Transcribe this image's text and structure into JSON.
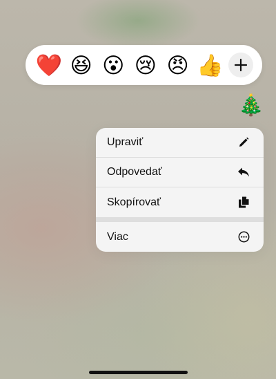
{
  "reactions": [
    {
      "emoji": "❤️",
      "name": "red-heart"
    },
    {
      "emoji": "😆",
      "name": "laughing"
    },
    {
      "emoji": "😮",
      "name": "surprised"
    },
    {
      "emoji": "😢",
      "name": "crying"
    },
    {
      "emoji": "😠",
      "name": "angry"
    },
    {
      "emoji": "👍",
      "name": "thumbs-up"
    }
  ],
  "add_reaction_icon": "plus-icon",
  "message": {
    "emoji": "🎄"
  },
  "menu": {
    "items": [
      {
        "label": "Upraviť",
        "icon": "pencil-icon"
      },
      {
        "label": "Odpovedať",
        "icon": "reply-icon"
      },
      {
        "label": "Skopírovať",
        "icon": "copy-icon"
      },
      {
        "label": "Viac",
        "icon": "more-circle-icon"
      }
    ]
  },
  "colors": {
    "menu_background": "#f4f4f4",
    "reaction_bar_background": "#ffffff",
    "text": "#111111"
  }
}
